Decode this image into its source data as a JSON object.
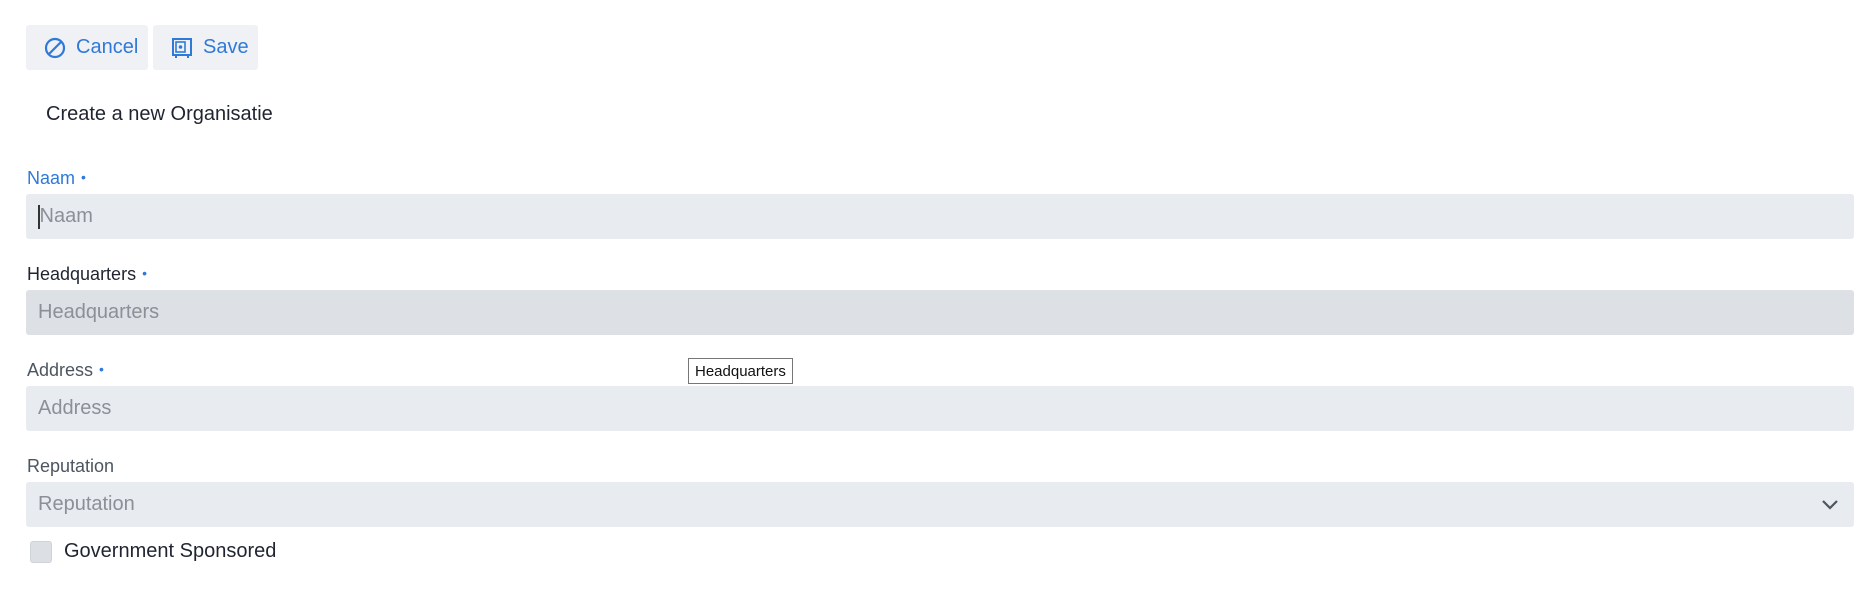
{
  "toolbar": {
    "cancel_label": "Cancel",
    "save_label": "Save"
  },
  "form": {
    "title": "Create a new Organisatie",
    "fields": {
      "naam": {
        "label": "Naam",
        "placeholder": "Naam",
        "required_marker": "•"
      },
      "headquarters": {
        "label": "Headquarters",
        "placeholder": "Headquarters",
        "required_marker": "•"
      },
      "address": {
        "label": "Address",
        "placeholder": "Address",
        "required_marker": "•"
      },
      "reputation": {
        "label": "Reputation",
        "placeholder": "Reputation"
      }
    },
    "checkbox": {
      "label": "Government Sponsored",
      "checked": false
    }
  },
  "tooltip": {
    "text": "Headquarters"
  },
  "colors": {
    "accent": "#2f7ad8",
    "input_bg": "#e8ebef",
    "toolbar_bg": "#eff1f4"
  },
  "icons": {
    "cancel": "prohibit-icon",
    "save": "save-icon",
    "select": "chevron-down-icon"
  }
}
